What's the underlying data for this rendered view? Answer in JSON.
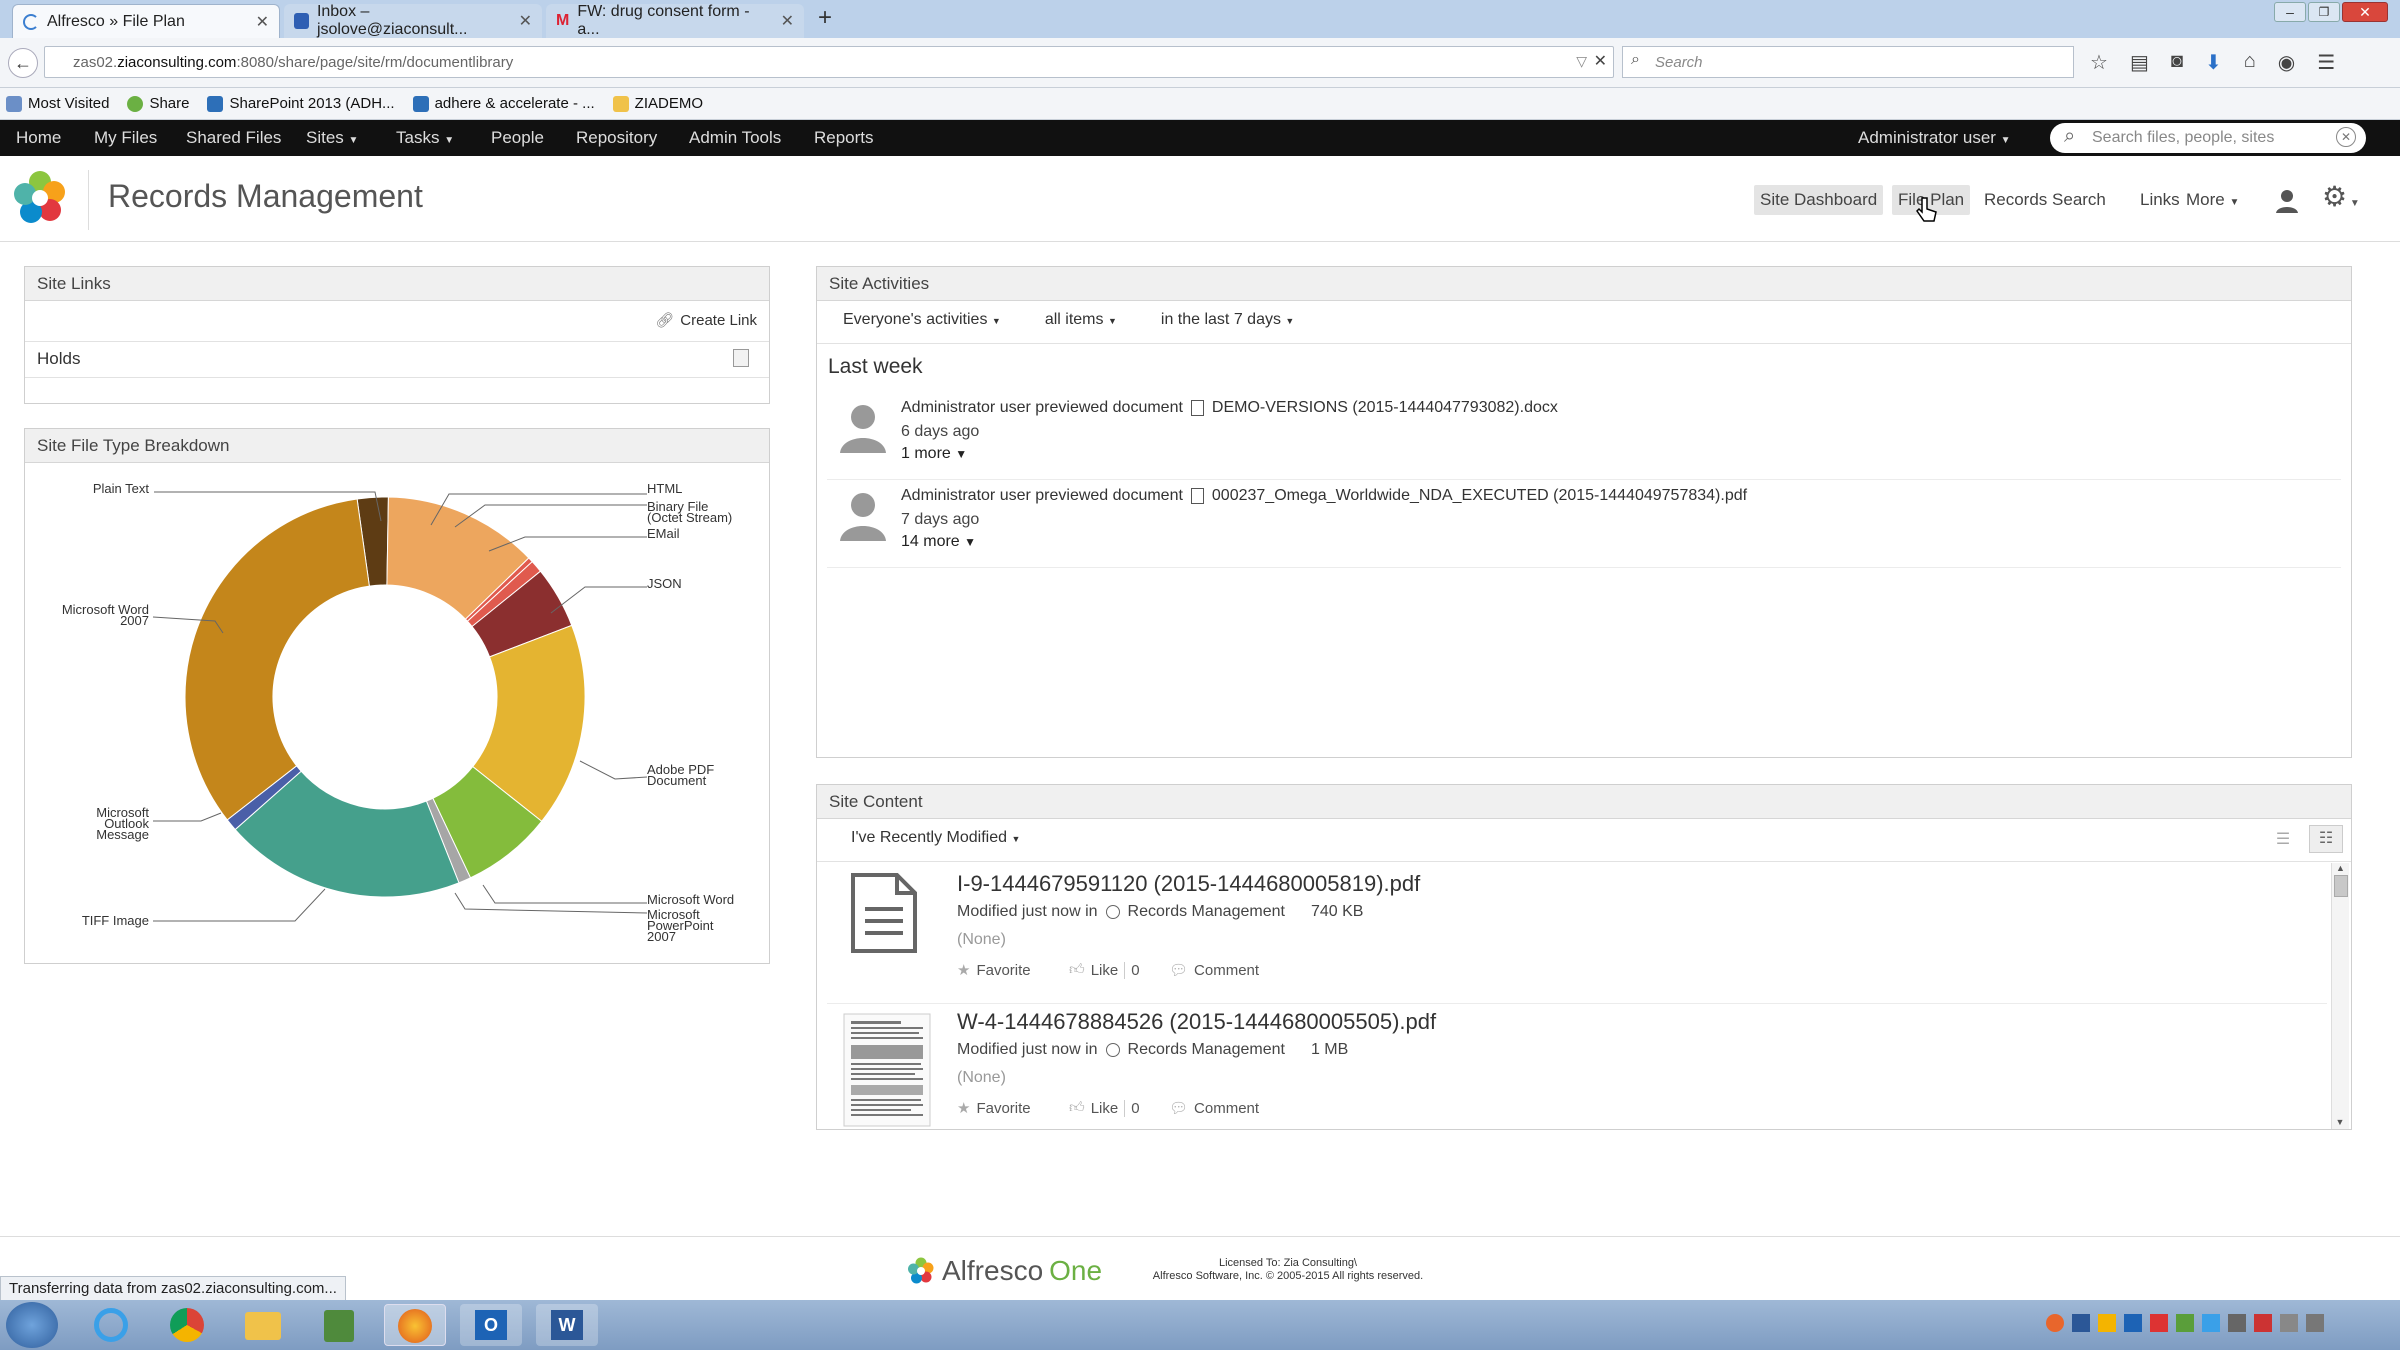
{
  "browser": {
    "tabs": [
      {
        "label": "Alfresco » File Plan",
        "active": true
      },
      {
        "label": "Inbox – jsolove@ziaconsult...",
        "active": false
      },
      {
        "label": "FW: drug consent form - a...",
        "active": false
      }
    ],
    "url_prefix": "zas02.",
    "url_domain": "ziaconsulting.com",
    "url_rest": ":8080/share/page/site/rm/documentlibrary",
    "search_placeholder": "Search",
    "bookmarks": [
      "Most Visited",
      "Share",
      "SharePoint 2013 (ADH...",
      "adhere & accelerate - ...",
      "ZIADEMO"
    ]
  },
  "app_nav": {
    "items": [
      "Home",
      "My Files",
      "Shared Files",
      "Sites",
      "Tasks",
      "People",
      "Repository",
      "Admin Tools",
      "Reports"
    ],
    "user": "Administrator user",
    "search_placeholder": "Search files, people, sites"
  },
  "site": {
    "title": "Records Management",
    "nav": [
      "Site Dashboard",
      "File Plan",
      "Records Search",
      "Links",
      "More"
    ]
  },
  "site_links": {
    "title": "Site Links",
    "create_link": "Create Link",
    "items": [
      "Holds"
    ]
  },
  "file_type": {
    "title": "Site File Type Breakdown",
    "labels": {
      "plain_text": "Plain Text",
      "word2007_a": "Microsoft Word",
      "word2007_b": "2007",
      "outlook_a": "Microsoft",
      "outlook_b": "Outlook",
      "outlook_c": "Message",
      "tiff": "TIFF Image",
      "html": "HTML",
      "binary_a": "Binary File",
      "binary_b": "(Octet Stream)",
      "email": "EMail",
      "json": "JSON",
      "pdf_a": "Adobe PDF",
      "pdf_b": "Document",
      "word": "Microsoft Word",
      "ppt_a": "Microsoft",
      "ppt_b": "PowerPoint",
      "ppt_c": "2007"
    }
  },
  "chart_data": {
    "type": "pie",
    "categories": [
      "Plain Text",
      "HTML",
      "Binary File (Octet Stream)",
      "EMail",
      "JSON",
      "Adobe PDF Document",
      "Microsoft Word",
      "Microsoft PowerPoint 2007",
      "TIFF Image",
      "Microsoft Outlook Message",
      "Microsoft Word 2007"
    ],
    "values": [
      2.5,
      12.5,
      0.4,
      1.0,
      5.0,
      16.5,
      7.3,
      1.0,
      19.5,
      1.0,
      33.3
    ],
    "colors": [
      "#5e3c14",
      "#eda65e",
      "#e05a4e",
      "#e05a4e",
      "#8b2f2f",
      "#e4b431",
      "#84bc3c",
      "#a6a6a6",
      "#45a08c",
      "#4a5fa8",
      "#c4861b"
    ],
    "donut": true
  },
  "activities": {
    "title": "Site Activities",
    "filters": [
      "Everyone's activities",
      "all items",
      "in the last 7 days"
    ],
    "group": "Last week",
    "items": [
      {
        "text": "Administrator user previewed document",
        "doc": "DEMO-VERSIONS (2015-1444047793082).docx",
        "time": "6 days ago",
        "more": "1 more"
      },
      {
        "text": "Administrator user previewed document",
        "doc": "000237_Omega_Worldwide_NDA_EXECUTED (2015-1444049757834).pdf",
        "time": "7 days ago",
        "more": "14 more"
      }
    ]
  },
  "content": {
    "title": "Site Content",
    "filter": "I've Recently Modified",
    "items": [
      {
        "name": "I-9-1444679591120 (2015-1444680005819).pdf",
        "modified": "Modified just now in",
        "site": "Records Management",
        "size": "740 KB",
        "desc": "(None)",
        "favorite": "Favorite",
        "like": "Like",
        "likes": "0",
        "comment": "Comment"
      },
      {
        "name": "W-4-1444678884526 (2015-1444680005505).pdf",
        "modified": "Modified just now in",
        "site": "Records Management",
        "size": "1 MB",
        "desc": "(None)",
        "favorite": "Favorite",
        "like": "Like",
        "likes": "0",
        "comment": "Comment"
      }
    ]
  },
  "footer": {
    "logo_a": "Alfresco",
    "logo_b": "One",
    "license": "Licensed To: Zia Consulting\\",
    "copyright": "Alfresco Software, Inc. © 2005-2015 All rights reserved."
  },
  "status": "Transferring data from zas02.ziaconsulting.com..."
}
